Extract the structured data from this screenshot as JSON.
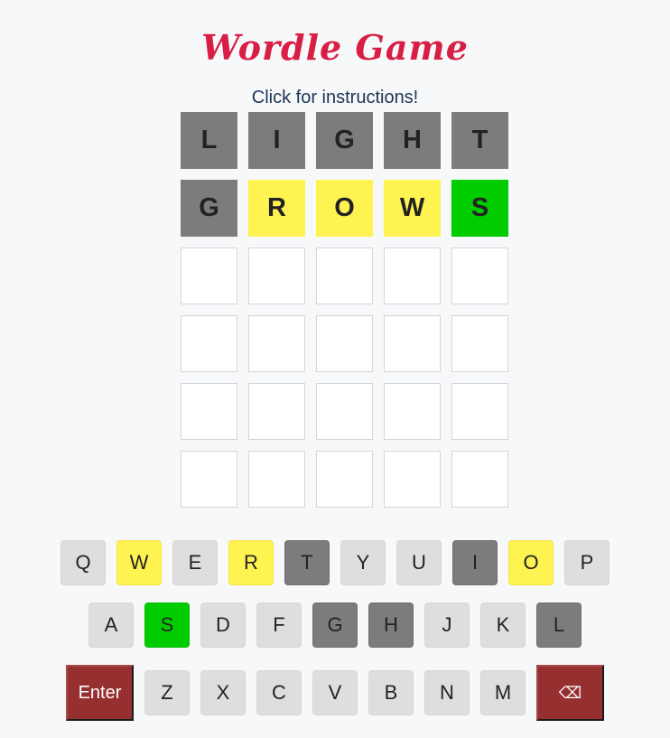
{
  "header": {
    "title": "Wordle Game",
    "instructions": "Click for instructions!"
  },
  "board": {
    "rows": [
      [
        {
          "letter": "L",
          "state": "absent"
        },
        {
          "letter": "I",
          "state": "absent"
        },
        {
          "letter": "G",
          "state": "absent"
        },
        {
          "letter": "H",
          "state": "absent"
        },
        {
          "letter": "T",
          "state": "absent"
        }
      ],
      [
        {
          "letter": "G",
          "state": "absent"
        },
        {
          "letter": "R",
          "state": "present"
        },
        {
          "letter": "O",
          "state": "present"
        },
        {
          "letter": "W",
          "state": "present"
        },
        {
          "letter": "S",
          "state": "correct"
        }
      ],
      [
        {
          "letter": "",
          "state": "empty"
        },
        {
          "letter": "",
          "state": "empty"
        },
        {
          "letter": "",
          "state": "empty"
        },
        {
          "letter": "",
          "state": "empty"
        },
        {
          "letter": "",
          "state": "empty"
        }
      ],
      [
        {
          "letter": "",
          "state": "empty"
        },
        {
          "letter": "",
          "state": "empty"
        },
        {
          "letter": "",
          "state": "empty"
        },
        {
          "letter": "",
          "state": "empty"
        },
        {
          "letter": "",
          "state": "empty"
        }
      ],
      [
        {
          "letter": "",
          "state": "empty"
        },
        {
          "letter": "",
          "state": "empty"
        },
        {
          "letter": "",
          "state": "empty"
        },
        {
          "letter": "",
          "state": "empty"
        },
        {
          "letter": "",
          "state": "empty"
        }
      ],
      [
        {
          "letter": "",
          "state": "empty"
        },
        {
          "letter": "",
          "state": "empty"
        },
        {
          "letter": "",
          "state": "empty"
        },
        {
          "letter": "",
          "state": "empty"
        },
        {
          "letter": "",
          "state": "empty"
        }
      ]
    ]
  },
  "keyboard": {
    "row1": [
      {
        "label": "Q",
        "state": "default"
      },
      {
        "label": "W",
        "state": "present"
      },
      {
        "label": "E",
        "state": "default"
      },
      {
        "label": "R",
        "state": "present"
      },
      {
        "label": "T",
        "state": "absent"
      },
      {
        "label": "Y",
        "state": "default"
      },
      {
        "label": "U",
        "state": "default"
      },
      {
        "label": "I",
        "state": "absent"
      },
      {
        "label": "O",
        "state": "present"
      },
      {
        "label": "P",
        "state": "default"
      }
    ],
    "row2": [
      {
        "label": "A",
        "state": "default"
      },
      {
        "label": "S",
        "state": "correct"
      },
      {
        "label": "D",
        "state": "default"
      },
      {
        "label": "F",
        "state": "default"
      },
      {
        "label": "G",
        "state": "absent"
      },
      {
        "label": "H",
        "state": "absent"
      },
      {
        "label": "J",
        "state": "default"
      },
      {
        "label": "K",
        "state": "default"
      },
      {
        "label": "L",
        "state": "absent"
      }
    ],
    "row3": [
      {
        "label": "Z",
        "state": "default"
      },
      {
        "label": "X",
        "state": "default"
      },
      {
        "label": "C",
        "state": "default"
      },
      {
        "label": "V",
        "state": "default"
      },
      {
        "label": "B",
        "state": "default"
      },
      {
        "label": "N",
        "state": "default"
      },
      {
        "label": "M",
        "state": "default"
      }
    ],
    "enter_label": "Enter",
    "backspace_icon": "⌫"
  },
  "colors": {
    "absent": "#7c7c7c",
    "present": "#fff352",
    "correct": "#00cc00",
    "title": "#d81e44",
    "action_key": "#962f2f"
  }
}
